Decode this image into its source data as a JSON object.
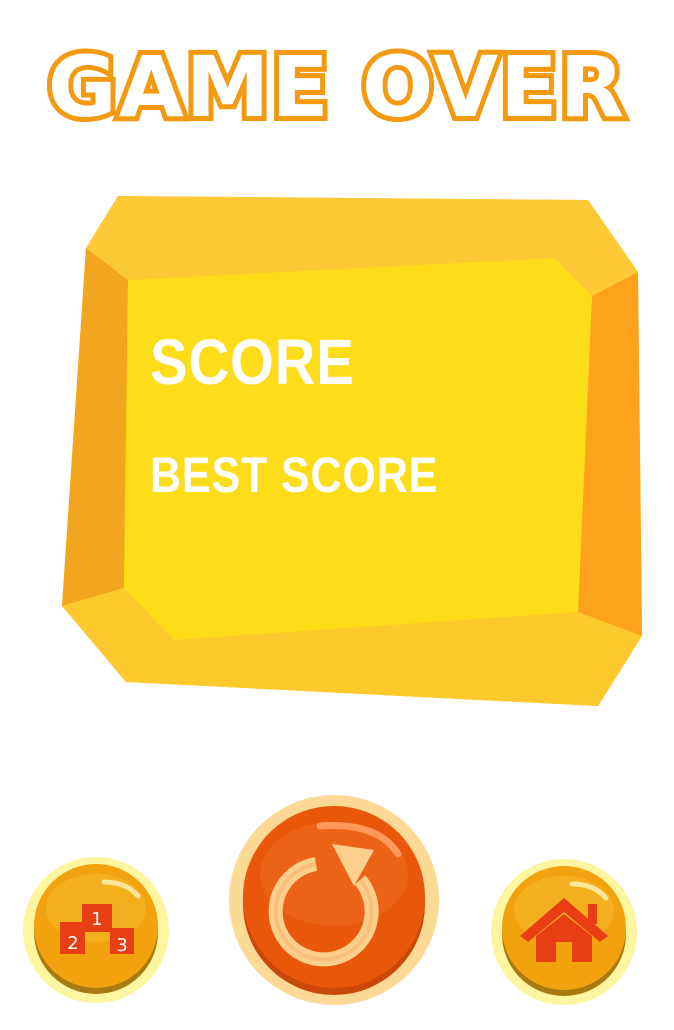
{
  "screen": {
    "title": "GAME OVER",
    "score_label": "SCORE",
    "best_score_label": "BEST SCORE"
  },
  "buttons": {
    "leaderboard": {
      "icon": "podium-icon",
      "ranks": [
        "1",
        "2",
        "3"
      ]
    },
    "replay": {
      "icon": "replay-icon"
    },
    "home": {
      "icon": "home-icon"
    }
  },
  "colors": {
    "title_outline": "#f39a12",
    "panel_face": "#fddc1a",
    "panel_rim": "#fdc92c",
    "replay_button": "#e9570a",
    "side_button": "#f2a20f",
    "icon_red": "#e83e14"
  }
}
